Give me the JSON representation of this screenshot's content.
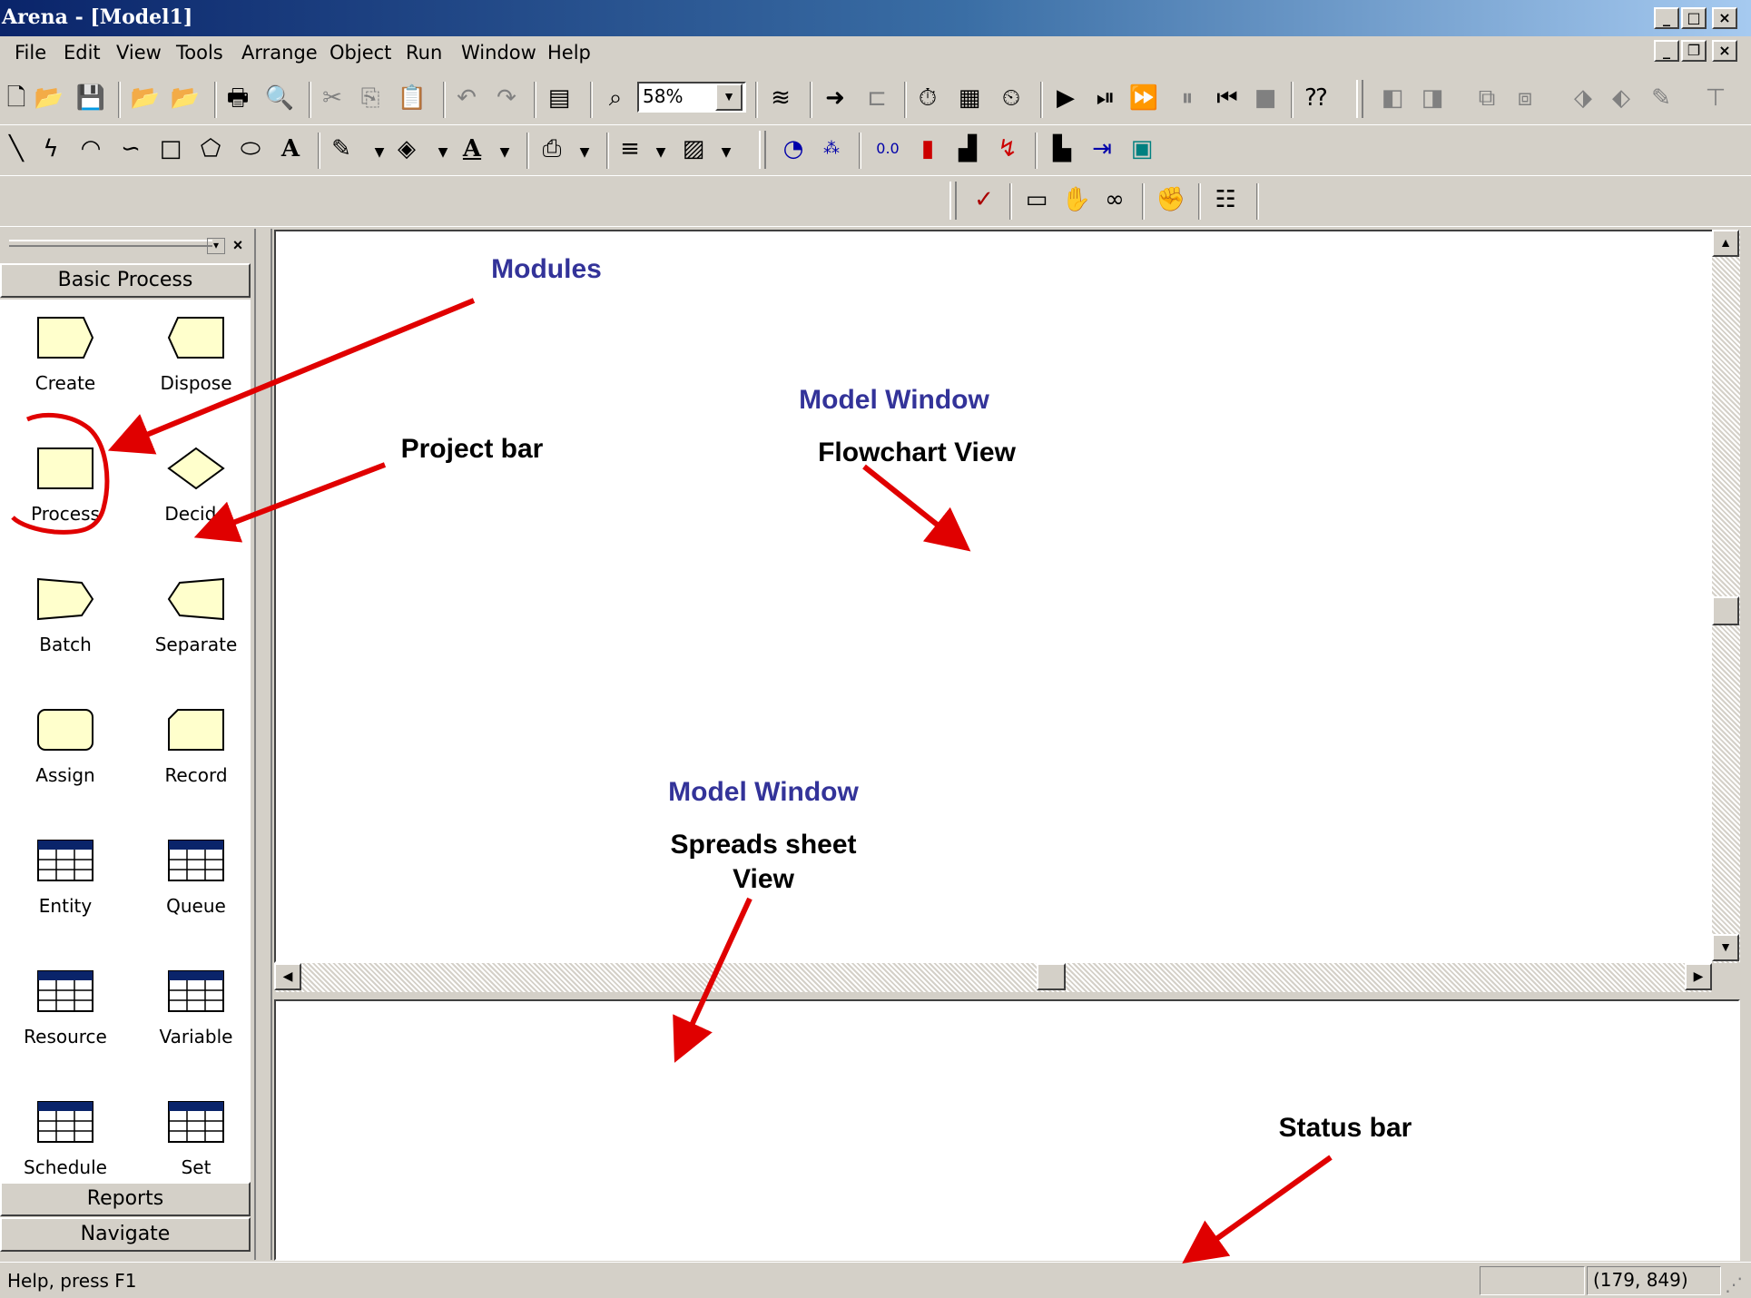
{
  "window": {
    "title": "Arena - [Model1]"
  },
  "menu": [
    "File",
    "Edit",
    "View",
    "Tools",
    "Arrange",
    "Object",
    "Run",
    "Window",
    "Help"
  ],
  "toolbar": {
    "zoom_value": "58%"
  },
  "project_bar": {
    "panel_title": "Basic Process",
    "modules": [
      {
        "label": "Create",
        "shape": "create"
      },
      {
        "label": "Dispose",
        "shape": "dispose"
      },
      {
        "label": "Process",
        "shape": "process"
      },
      {
        "label": "Decide",
        "shape": "decide"
      },
      {
        "label": "Batch",
        "shape": "batch"
      },
      {
        "label": "Separate",
        "shape": "separate"
      },
      {
        "label": "Assign",
        "shape": "assign"
      },
      {
        "label": "Record",
        "shape": "record"
      },
      {
        "label": "Entity",
        "shape": "table"
      },
      {
        "label": "Queue",
        "shape": "table"
      },
      {
        "label": "Resource",
        "shape": "table"
      },
      {
        "label": "Variable",
        "shape": "table"
      },
      {
        "label": "Schedule",
        "shape": "table"
      },
      {
        "label": "Set",
        "shape": "table"
      }
    ],
    "bottom_panels": [
      "Reports",
      "Navigate"
    ]
  },
  "annotations": {
    "modules": "Modules",
    "project_bar": "Project bar",
    "model_window_1": "Model Window",
    "flowchart_view": "Flowchart View",
    "model_window_2": "Model Window",
    "spreadsheet_view_line1": "Spreads sheet",
    "spreadsheet_view_line2": "View",
    "status_bar": "Status bar"
  },
  "status": {
    "help_text": "Help, press F1",
    "coords": "(179, 849)"
  },
  "colors": {
    "module_fill": "#ffffcc",
    "annotation_blue": "#333399",
    "arrow_red": "#e00000",
    "title_bar": "#0a246a"
  }
}
